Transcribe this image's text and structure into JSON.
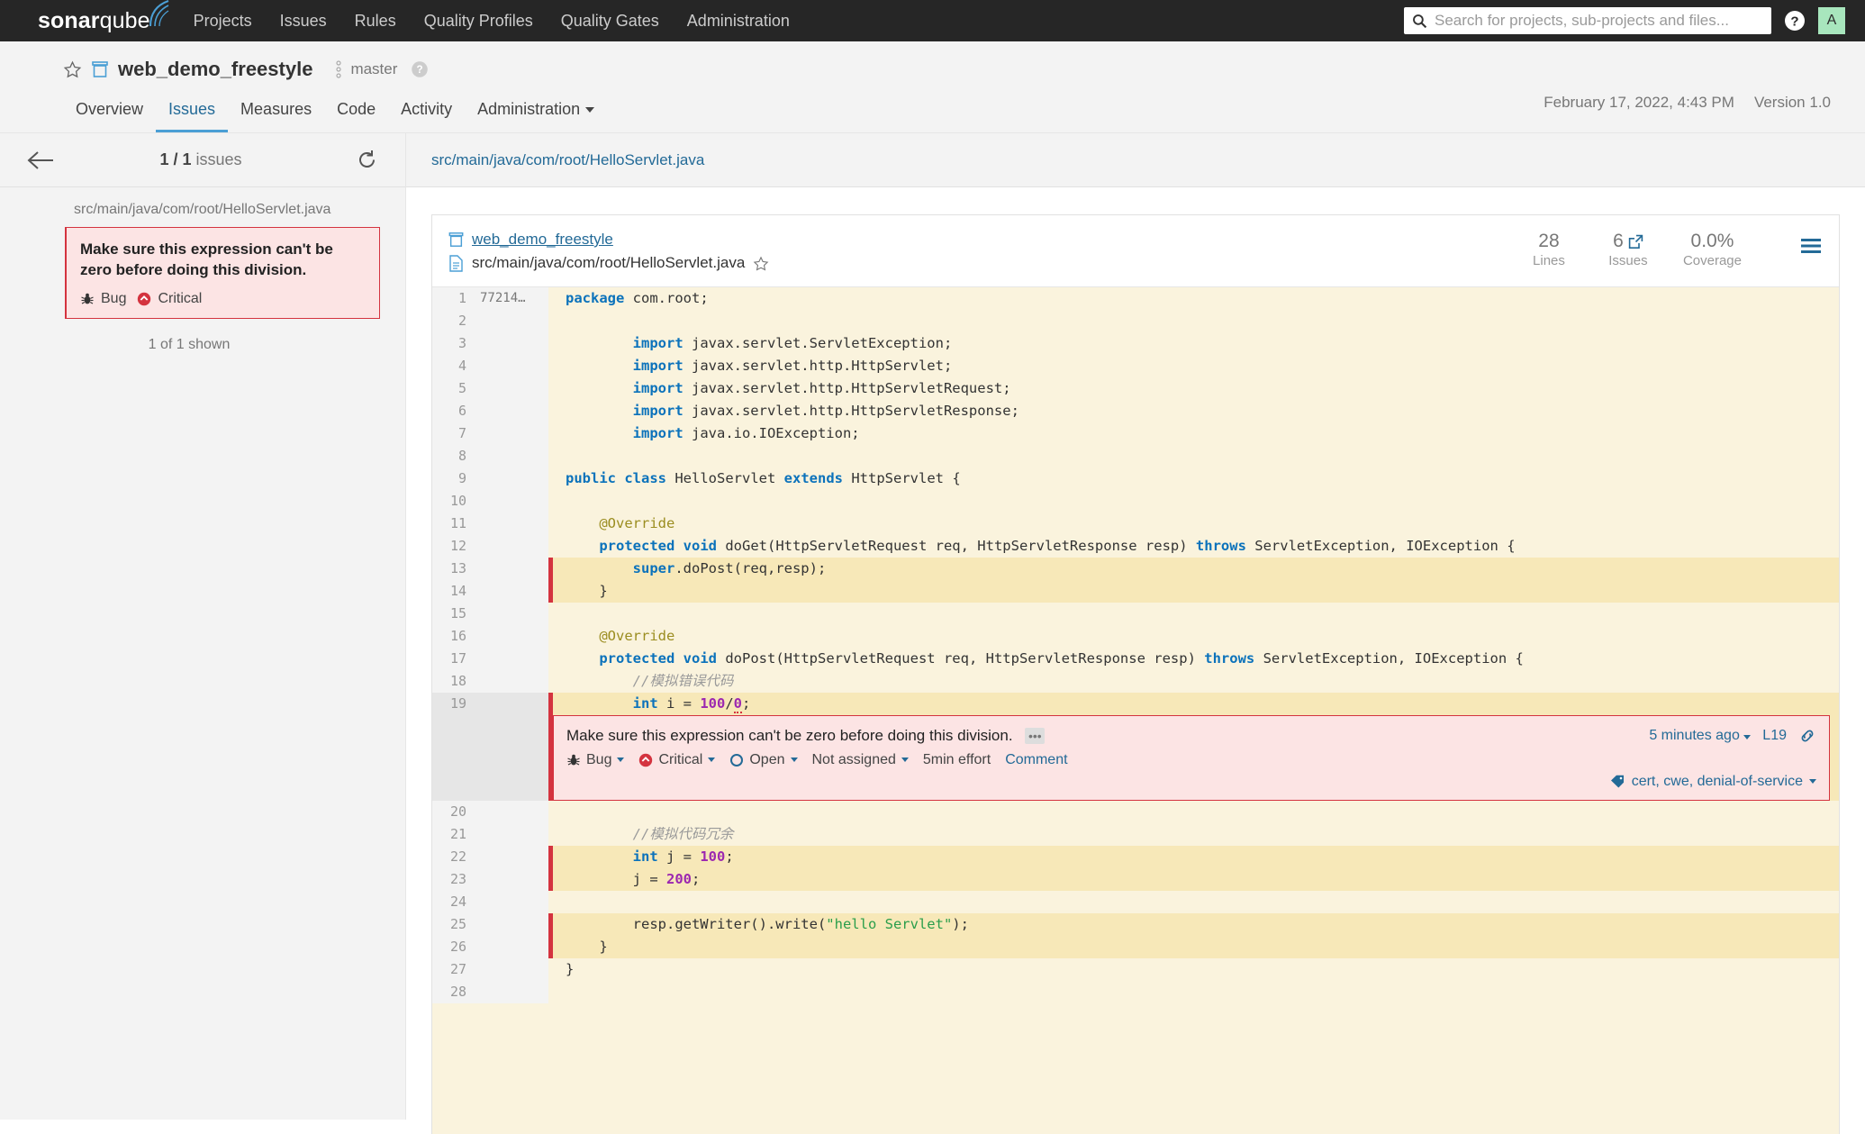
{
  "topnav": {
    "logo_bold": "sonar",
    "logo_light": "qube",
    "links": [
      "Projects",
      "Issues",
      "Rules",
      "Quality Profiles",
      "Quality Gates",
      "Administration"
    ],
    "search_placeholder": "Search for projects, sub-projects and files...",
    "search_value": "",
    "help_label": "?",
    "avatar_initial": "A"
  },
  "project": {
    "name": "web_demo_freestyle",
    "branch": "master",
    "analysis_date": "February 17, 2022, 4:43 PM",
    "version": "Version 1.0",
    "tabs": [
      {
        "label": "Overview",
        "active": false
      },
      {
        "label": "Issues",
        "active": true
      },
      {
        "label": "Measures",
        "active": false
      },
      {
        "label": "Code",
        "active": false
      },
      {
        "label": "Activity",
        "active": false
      },
      {
        "label": "Administration",
        "active": false,
        "has_caret": true
      }
    ]
  },
  "sidebar": {
    "issue_index": "1 / 1",
    "issue_count_suffix": "issues",
    "file_path": "src/main/java/com/root/HelloServlet.java",
    "issue": {
      "message": "Make sure this expression can't be zero before doing this division.",
      "type": "Bug",
      "severity": "Critical"
    },
    "shown": "1 of 1 shown"
  },
  "main": {
    "breadcrumb": "src/main/java/com/root/HelloServlet.java",
    "file_card": {
      "project_link": "web_demo_freestyle",
      "file_name": "src/main/java/com/root/HelloServlet.java",
      "metrics": [
        {
          "value": "28",
          "label": "Lines"
        },
        {
          "value": "6",
          "label": "Issues",
          "external": true
        },
        {
          "value": "0.0%",
          "label": "Coverage"
        }
      ]
    }
  },
  "code": {
    "lines": [
      {
        "n": "1",
        "scm": "77214…",
        "cov": "none",
        "dark": false,
        "html": "<span class=\"k\">package</span> com.root;"
      },
      {
        "n": "2",
        "scm": "",
        "cov": "none",
        "dark": false,
        "html": ""
      },
      {
        "n": "3",
        "scm": "",
        "cov": "none",
        "dark": false,
        "html": "        <span class=\"k\">import</span> javax.servlet.ServletException;"
      },
      {
        "n": "4",
        "scm": "",
        "cov": "none",
        "dark": false,
        "html": "        <span class=\"k\">import</span> javax.servlet.http.HttpServlet;"
      },
      {
        "n": "5",
        "scm": "",
        "cov": "none",
        "dark": false,
        "html": "        <span class=\"k\">import</span> javax.servlet.http.HttpServletRequest;"
      },
      {
        "n": "6",
        "scm": "",
        "cov": "none",
        "dark": false,
        "html": "        <span class=\"k\">import</span> javax.servlet.http.HttpServletResponse;"
      },
      {
        "n": "7",
        "scm": "",
        "cov": "none",
        "dark": false,
        "html": "        <span class=\"k\">import</span> java.io.IOException;"
      },
      {
        "n": "8",
        "scm": "",
        "cov": "none",
        "dark": false,
        "html": ""
      },
      {
        "n": "9",
        "scm": "",
        "cov": "none",
        "dark": false,
        "html": "<span class=\"k\">public</span> <span class=\"k\">class</span> HelloServlet <span class=\"k\">extends</span> HttpServlet {"
      },
      {
        "n": "10",
        "scm": "",
        "cov": "none",
        "dark": false,
        "html": ""
      },
      {
        "n": "11",
        "scm": "",
        "cov": "none",
        "dark": false,
        "html": "    <span class=\"ann\">@Override</span>"
      },
      {
        "n": "12",
        "scm": "",
        "cov": "none",
        "dark": false,
        "html": "    <span class=\"k\">protected</span> <span class=\"k\">void</span> doGet(HttpServletRequest req, HttpServletResponse resp) <span class=\"k\">throws</span> ServletException, IOException {"
      },
      {
        "n": "13",
        "scm": "",
        "cov": "uncovered",
        "dark": true,
        "html": "        <span class=\"k\">super</span>.doPost(req,resp);"
      },
      {
        "n": "14",
        "scm": "",
        "cov": "uncovered",
        "dark": true,
        "html": "    }"
      },
      {
        "n": "15",
        "scm": "",
        "cov": "none",
        "dark": false,
        "html": ""
      },
      {
        "n": "16",
        "scm": "",
        "cov": "none",
        "dark": false,
        "html": "    <span class=\"ann\">@Override</span>"
      },
      {
        "n": "17",
        "scm": "",
        "cov": "none",
        "dark": false,
        "html": "    <span class=\"k\">protected</span> <span class=\"k\">void</span> doPost(HttpServletRequest req, HttpServletResponse resp) <span class=\"k\">throws</span> ServletException, IOException {"
      },
      {
        "n": "18",
        "scm": "",
        "cov": "none",
        "dark": false,
        "html": "        <span class=\"cmt\">//模拟错误代码</span>"
      },
      {
        "n": "19",
        "scm": "",
        "cov": "uncovered",
        "dark": true,
        "selected": true,
        "html": "        <span class=\"k\">int</span> i = <span class=\"num\">100</span>/<span class=\"num sq\">0</span>;"
      }
    ],
    "lines_after": [
      {
        "n": "20",
        "scm": "",
        "cov": "none",
        "dark": false,
        "html": ""
      },
      {
        "n": "21",
        "scm": "",
        "cov": "none",
        "dark": false,
        "html": "        <span class=\"cmt\">//模拟代码冗余</span>"
      },
      {
        "n": "22",
        "scm": "",
        "cov": "uncovered",
        "dark": true,
        "html": "        <span class=\"k\">int</span> j = <span class=\"num\">100</span>;"
      },
      {
        "n": "23",
        "scm": "",
        "cov": "uncovered",
        "dark": true,
        "html": "        j = <span class=\"num\">200</span>;"
      },
      {
        "n": "24",
        "scm": "",
        "cov": "none",
        "dark": false,
        "html": ""
      },
      {
        "n": "25",
        "scm": "",
        "cov": "uncovered",
        "dark": true,
        "html": "        resp.getWriter().write(<span class=\"str\">\"hello Servlet\"</span>);"
      },
      {
        "n": "26",
        "scm": "",
        "cov": "uncovered",
        "dark": true,
        "html": "    }"
      },
      {
        "n": "27",
        "scm": "",
        "cov": "none",
        "dark": false,
        "html": "}"
      },
      {
        "n": "28",
        "scm": "",
        "cov": "none",
        "dark": false,
        "html": ""
      }
    ]
  },
  "inline_issue": {
    "message": "Make sure this expression can't be zero before doing this division.",
    "rule_button": "•••",
    "age": "5 minutes ago",
    "line_ref": "L19",
    "type": "Bug",
    "severity": "Critical",
    "status": "Open",
    "assignee": "Not assigned",
    "effort": "5min effort",
    "comment": "Comment",
    "tags": "cert, cwe, denial-of-service"
  },
  "colors": {
    "nav_bg": "#262626",
    "accent_blue": "#236a97",
    "tab_underline": "#4b9fd5",
    "danger_red": "#d4333f",
    "issue_bg": "#fce4e4",
    "code_bg": "#faf3dd",
    "code_bg_dark": "#f7e8b8",
    "avatar_green": "#a8e6bd"
  }
}
